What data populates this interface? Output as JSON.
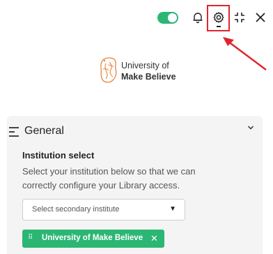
{
  "toolbar": {
    "toggle_state": "on",
    "icons": [
      "bell-icon",
      "gear-icon",
      "shrink-icon",
      "close-icon"
    ],
    "accent_color": "#2bb673",
    "highlight_color": "#e0242b"
  },
  "logo": {
    "line1": "University of",
    "line2": "Make Believe",
    "mark_color": "#e8833a"
  },
  "panel": {
    "title": "General",
    "field_label": "Institution select",
    "field_description": "Select your institution below so that we can correctly configure your Library access.",
    "select_placeholder": "Select secondary institute",
    "selected_chip": "University of Make Believe"
  }
}
